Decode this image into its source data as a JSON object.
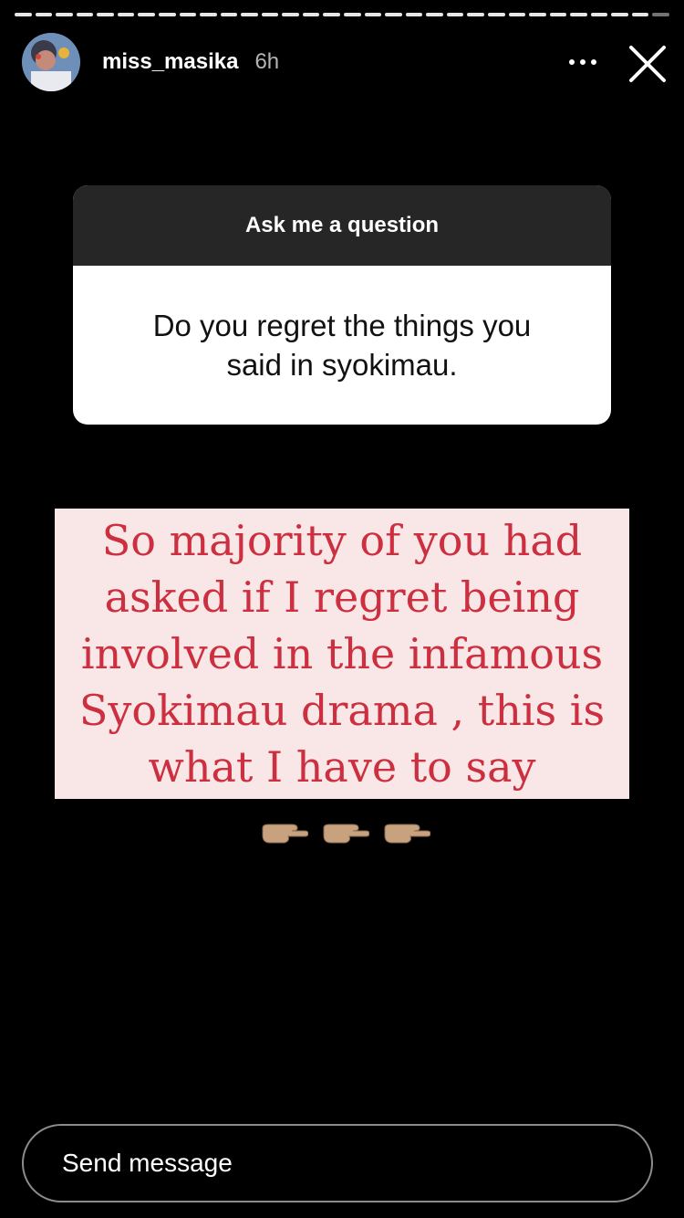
{
  "story": {
    "progress_segments": 32,
    "progress_done": 31
  },
  "header": {
    "username": "miss_masika",
    "time": "6h",
    "more_icon": "more-horizontal-icon",
    "close_icon": "close-icon"
  },
  "question_sticker": {
    "title": "Ask me a question",
    "question": "Do you regret the things you said in syokimau."
  },
  "note": {
    "text": "So majority of you had asked if I regret being involved in the infamous Syokimau drama , this is what I have to say",
    "emoji": "pointing-right-hand-icon x3"
  },
  "composer": {
    "placeholder": "Send message"
  },
  "colors": {
    "background": "#000000",
    "sticker_header": "#262626",
    "note_background": "#f9e6e6",
    "note_text": "#cc2f3f"
  }
}
